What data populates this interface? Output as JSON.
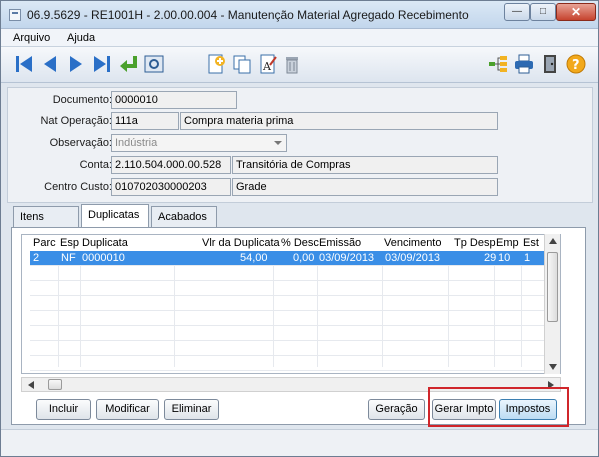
{
  "window": {
    "title": "06.9.5629 - RE1001H - 2.00.00.004 - Manutenção Material Agregado Recebimento",
    "minimize_glyph": "—",
    "maximize_glyph": "□",
    "close_glyph": "✕"
  },
  "menu": [
    {
      "label": "Arquivo"
    },
    {
      "label": "Ajuda"
    }
  ],
  "toolbar": {
    "icons": [
      "first-icon",
      "previous-icon",
      "next-icon",
      "last-icon",
      "go-to-icon",
      "search-icon",
      "add-icon",
      "copy-icon",
      "edit-icon",
      "delete-icon",
      "tree-icon",
      "print-icon",
      "exit-icon",
      "help-icon"
    ]
  },
  "form": {
    "documento_label": "Documento:",
    "documento_value": "0000010",
    "nat_operacao_label": "Nat Operação:",
    "nat_operacao_code": "111a",
    "nat_operacao_desc": "Compra materia prima",
    "observacao_label": "Observação:",
    "observacao_value": "Indústria",
    "conta_label": "Conta:",
    "conta_code": "2.110.504.000.00.528",
    "conta_desc": "Transitória de Compras",
    "centro_custo_label": "Centro Custo:",
    "centro_custo_code": "010702030000203",
    "centro_custo_desc": "Grade"
  },
  "tabs": [
    {
      "label": "Itens"
    },
    {
      "label": "Duplicatas"
    },
    {
      "label": "Acabados"
    }
  ],
  "grid": {
    "headers": [
      "Parc",
      "Esp",
      "Duplicata",
      "Vlr da Duplicata",
      "% Desc",
      "Emissão",
      "Vencimento",
      "Tp Desp",
      "Emp",
      "Est"
    ],
    "rows": [
      {
        "parc": "2",
        "esp": "NF",
        "duplicata": "0000010",
        "vlr": "54,00",
        "desc": "0,00",
        "emissao": "03/09/2013",
        "vencimento": "03/09/2013",
        "tp_desp": "29",
        "emp": "10",
        "est": "1"
      }
    ]
  },
  "buttons": {
    "incluir": "Incluir",
    "modificar": "Modificar",
    "eliminar": "Eliminar",
    "geracao": "Geração",
    "gerar_impto": "Gerar Impto",
    "impostos": "Impostos"
  },
  "colors": {
    "selection": "#3a8ee6",
    "highlight_box": "#d0262b"
  }
}
